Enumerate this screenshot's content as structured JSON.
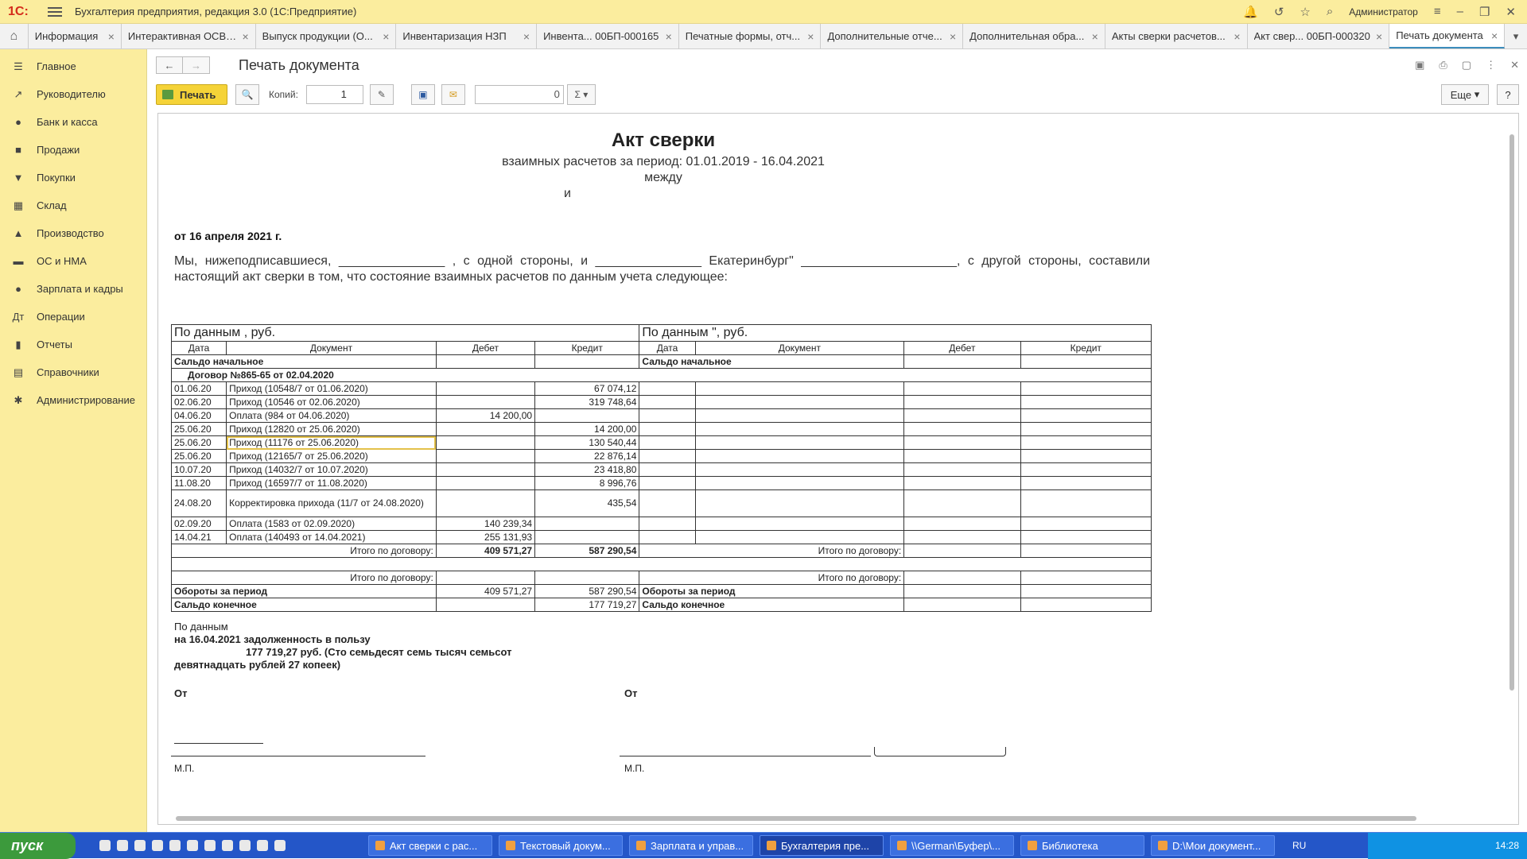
{
  "app": {
    "logo": "1С:",
    "title": "Бухгалтерия предприятия, редакция 3.0  (1С:Предприятие)",
    "user": "Администратор"
  },
  "tabs": [
    {
      "label": "Информация",
      "w": 118
    },
    {
      "label": "Интерактивная ОСВ: ...",
      "w": 170
    },
    {
      "label": "Выпуск продукции (О...",
      "w": 178
    },
    {
      "label": "Инвентаризация НЗП",
      "w": 178
    },
    {
      "label": "Инвента... 00БП-000165",
      "w": 180
    },
    {
      "label": "Печатные формы, отч...",
      "w": 180
    },
    {
      "label": "Дополнительные отче...",
      "w": 180
    },
    {
      "label": "Дополнительная обра...",
      "w": 180
    },
    {
      "label": "Акты сверки расчетов...",
      "w": 180
    },
    {
      "label": "Акт свер... 00БП-000320",
      "w": 180
    },
    {
      "label": "Печать документа",
      "w": 146,
      "active": true
    }
  ],
  "sidebar": [
    {
      "label": "Главное",
      "icon": "☰"
    },
    {
      "label": "Руководителю",
      "icon": "↗"
    },
    {
      "label": "Банк и касса",
      "icon": "●"
    },
    {
      "label": "Продажи",
      "icon": "■"
    },
    {
      "label": "Покупки",
      "icon": "▼"
    },
    {
      "label": "Склад",
      "icon": "▦"
    },
    {
      "label": "Производство",
      "icon": "▲"
    },
    {
      "label": "ОС и НМА",
      "icon": "▬"
    },
    {
      "label": "Зарплата и кадры",
      "icon": "●"
    },
    {
      "label": "Операции",
      "icon": "Дт"
    },
    {
      "label": "Отчеты",
      "icon": "▮"
    },
    {
      "label": "Справочники",
      "icon": "▤"
    },
    {
      "label": "Администрирование",
      "icon": "✱"
    }
  ],
  "form": {
    "title": "Печать документа",
    "print_label": "Печать",
    "copies_label": "Копий:",
    "copies_value": "1",
    "sum_value": "0",
    "more_label": "Еще",
    "help_label": "?"
  },
  "doc": {
    "title": "Акт сверки",
    "subtitle": "взаимных расчетов за период: 01.01.2019 - 16.04.2021",
    "between": "между",
    "and": "и",
    "date": "от 16 апреля 2021 г.",
    "intro": "Мы, нижеподписавшиеся, _______________ , с одной стороны, и _______________ Екатеринбург\" ______________________, с другой стороны, составили настоящий акт сверки в том, что состояние взаимных расчетов по данным учета следующее:",
    "left_header": "По данным , руб.",
    "right_header": "По данным \", руб.",
    "col_date": "Дата",
    "col_doc": "Документ",
    "col_debit": "Дебет",
    "col_credit": "Кредит",
    "opening": "Сальдо начальное",
    "contract": "Договор №865-65 от 02.04.2020",
    "rows": [
      {
        "date": "01.06.20",
        "doc": "Приход (10548/7 от 01.06.2020)",
        "debit": "",
        "credit": "67 074,12"
      },
      {
        "date": "02.06.20",
        "doc": "Приход (10546 от 02.06.2020)",
        "debit": "",
        "credit": "319 748,64"
      },
      {
        "date": "04.06.20",
        "doc": "Оплата (984 от 04.06.2020)",
        "debit": "14 200,00",
        "credit": ""
      },
      {
        "date": "25.06.20",
        "doc": "Приход (12820 от 25.06.2020)",
        "debit": "",
        "credit": "14 200,00"
      },
      {
        "date": "25.06.20",
        "doc": "Приход (11176 от 25.06.2020)",
        "debit": "",
        "credit": "130 540,44"
      },
      {
        "date": "25.06.20",
        "doc": "Приход (12165/7 от 25.06.2020)",
        "debit": "",
        "credit": "22 876,14"
      },
      {
        "date": "10.07.20",
        "doc": "Приход (14032/7 от 10.07.2020)",
        "debit": "",
        "credit": "23 418,80"
      },
      {
        "date": "11.08.20",
        "doc": "Приход (16597/7 от 11.08.2020)",
        "debit": "",
        "credit": "8 996,76"
      },
      {
        "date": "24.08.20",
        "doc": "Корректировка прихода (11/7 от 24.08.2020)",
        "debit": "",
        "credit": "435,54"
      },
      {
        "date": "02.09.20",
        "doc": "Оплата (1583 от 02.09.2020)",
        "debit": "140 239,34",
        "credit": ""
      },
      {
        "date": "14.04.21",
        "doc": "Оплата (140493 от 14.04.2021)",
        "debit": "255 131,93",
        "credit": ""
      }
    ],
    "contract_total_label": "Итого по договору:",
    "contract_total_debit": "409 571,27",
    "contract_total_credit": "587 290,54",
    "turnover_label": "Обороты за период",
    "turnover_debit": "409 571,27",
    "turnover_credit": "587 290,54",
    "closing_label": "Сальдо конечное",
    "closing_credit": "177 719,27",
    "footer_by": "По данным",
    "footer_debt": "на 16.04.2021 задолженность в пользу",
    "footer_amount": "177 719,27 руб. (Сто семьдесят семь тысяч семьсот",
    "footer_amount2": "девятнадцать рублей 27 копеек)",
    "from_label": "От",
    "mp_label": "М.П."
  },
  "taskbar": {
    "start": "пуск",
    "items": [
      {
        "label": "Акт сверки с рас...",
        "w": 156
      },
      {
        "label": "Текстовый докум...",
        "w": 156
      },
      {
        "label": "Зарплата и управ...",
        "w": 156
      },
      {
        "label": "Бухгалтерия пре...",
        "w": 156,
        "active": true
      },
      {
        "label": "\\\\German\\Буфер\\...",
        "w": 156
      },
      {
        "label": "Библиотека",
        "w": 156
      },
      {
        "label": "D:\\Мои документ...",
        "w": 156
      }
    ],
    "lang": "RU",
    "time": "14:28"
  }
}
